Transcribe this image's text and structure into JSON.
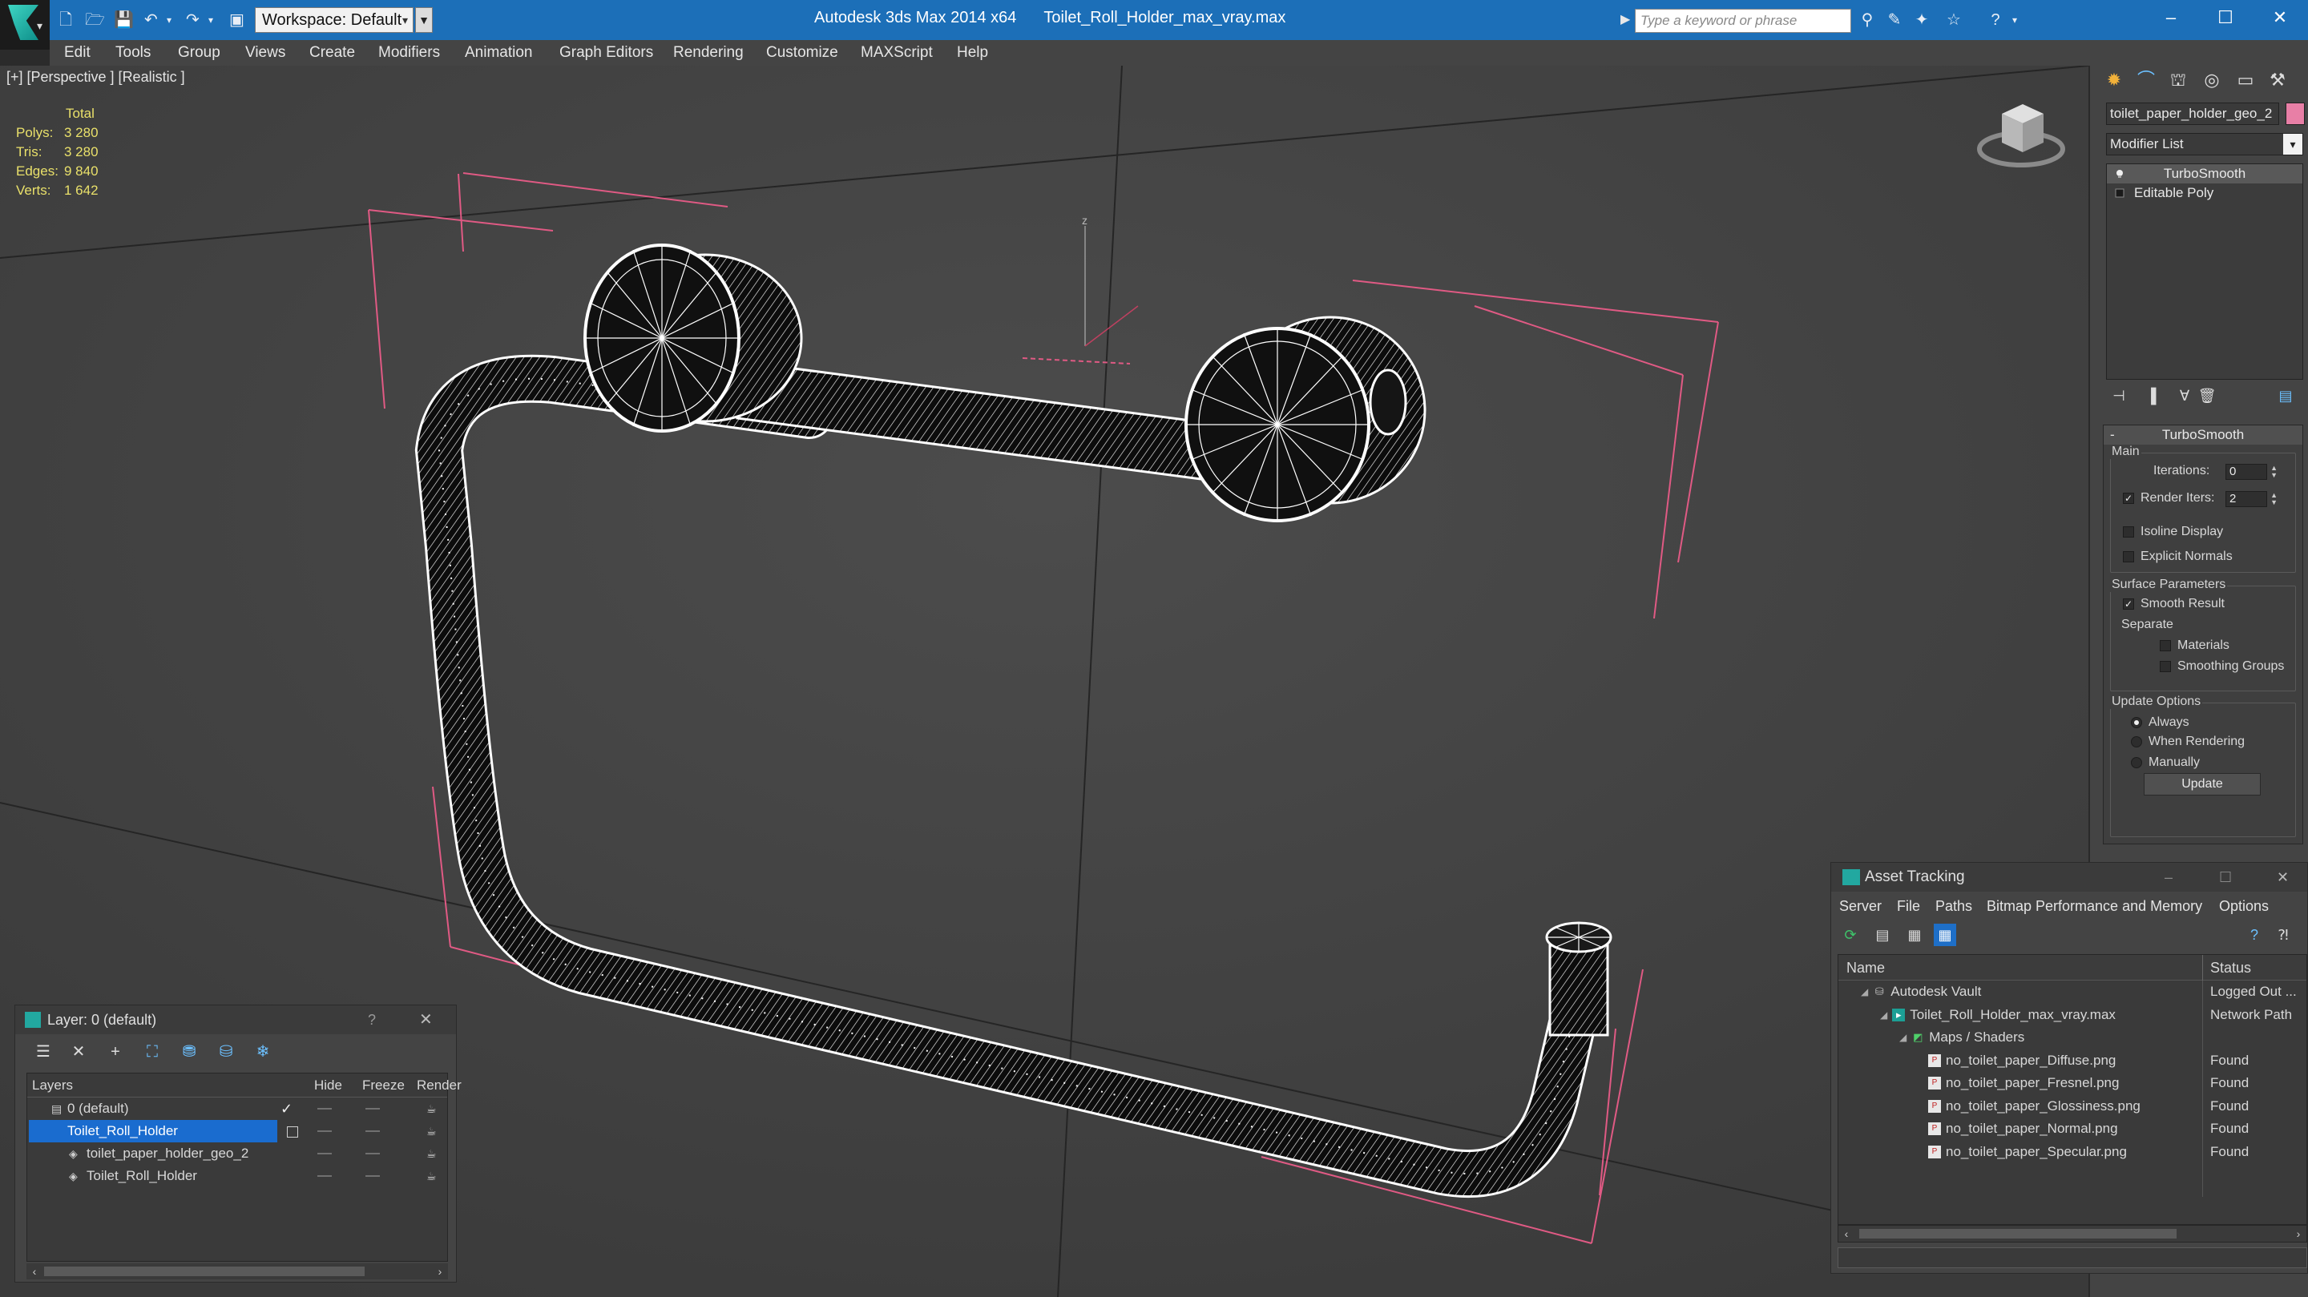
{
  "title_bar": {
    "workspace_label": "Workspace: Default",
    "app_name": "Autodesk 3ds Max  2014 x64",
    "file_name": "Toilet_Roll_Holder_max_vray.max",
    "search_placeholder": "Type a keyword or phrase",
    "window_controls": [
      "minimize-icon",
      "maximize-icon",
      "close-icon"
    ]
  },
  "menu": {
    "items": [
      "Edit",
      "Tools",
      "Group",
      "Views",
      "Create",
      "Modifiers",
      "Animation",
      "Graph Editors",
      "Rendering",
      "Customize",
      "MAXScript",
      "Help"
    ]
  },
  "viewport": {
    "label": "[+] [Perspective ] [Realistic ]",
    "stats": {
      "total_label": "Total",
      "rows": [
        {
          "key": "Polys:",
          "value": "3 280"
        },
        {
          "key": "Tris:",
          "value": "3 280"
        },
        {
          "key": "Edges:",
          "value": "9 840"
        },
        {
          "key": "Verts:",
          "value": "1 642"
        }
      ]
    },
    "axis_label": "z",
    "colors": {
      "background": "#444444",
      "wireframe": "#ffffff",
      "bounds": "#e05a84",
      "grid": "#2a2a2a"
    }
  },
  "command_panel": {
    "object_name": "toilet_paper_holder_geo_2",
    "object_color": "#e87fa6",
    "modifier_list_label": "Modifier List",
    "stack": [
      "TurboSmooth",
      "Editable Poly"
    ],
    "rollout": {
      "title": "TurboSmooth",
      "main_group": "Main",
      "iterations_label": "Iterations:",
      "iterations_value": "0",
      "render_iters_label": "Render Iters:",
      "render_iters_value": "2",
      "isoline_label": "Isoline Display",
      "explicit_normals_label": "Explicit Normals",
      "surface_group": "Surface Parameters",
      "smooth_result_label": "Smooth Result",
      "separate_label": "Separate",
      "materials_label": "Materials",
      "smoothing_groups_label": "Smoothing Groups",
      "update_group": "Update Options",
      "always_label": "Always",
      "when_rendering_label": "When Rendering",
      "manually_label": "Manually",
      "update_button": "Update"
    }
  },
  "layer_explorer": {
    "title": "Layer: 0 (default)",
    "help": "?",
    "columns": [
      "Layers",
      "Hide",
      "Freeze",
      "Render"
    ],
    "rows": [
      {
        "name": "0 (default)",
        "indent": 0,
        "current": true,
        "selected": false
      },
      {
        "name": "Toilet_Roll_Holder",
        "indent": 0,
        "current": false,
        "selected": true
      },
      {
        "name": "toilet_paper_holder_geo_2",
        "indent": 1,
        "current": false,
        "selected": false
      },
      {
        "name": "Toilet_Roll_Holder",
        "indent": 1,
        "current": false,
        "selected": false
      }
    ]
  },
  "asset_tracking": {
    "title": "Asset Tracking",
    "menu": [
      "Server",
      "File",
      "Paths",
      "Bitmap Performance and Memory",
      "Options"
    ],
    "columns": [
      "Name",
      "Status"
    ],
    "rows": [
      {
        "name": "Autodesk Vault",
        "status": "Logged Out ...",
        "indent": 1,
        "icon": "vault-icon"
      },
      {
        "name": "Toilet_Roll_Holder_max_vray.max",
        "status": "Network Path",
        "indent": 2,
        "icon": "max-file-icon"
      },
      {
        "name": "Maps / Shaders",
        "status": "",
        "indent": 3,
        "icon": "maps-icon"
      },
      {
        "name": "no_toilet_paper_Diffuse.png",
        "status": "Found",
        "indent": 4,
        "icon": "png-icon"
      },
      {
        "name": "no_toilet_paper_Fresnel.png",
        "status": "Found",
        "indent": 4,
        "icon": "png-icon"
      },
      {
        "name": "no_toilet_paper_Glossiness.png",
        "status": "Found",
        "indent": 4,
        "icon": "png-icon"
      },
      {
        "name": "no_toilet_paper_Normal.png",
        "status": "Found",
        "indent": 4,
        "icon": "png-icon"
      },
      {
        "name": "no_toilet_paper_Specular.png",
        "status": "Found",
        "indent": 4,
        "icon": "png-icon"
      }
    ]
  }
}
